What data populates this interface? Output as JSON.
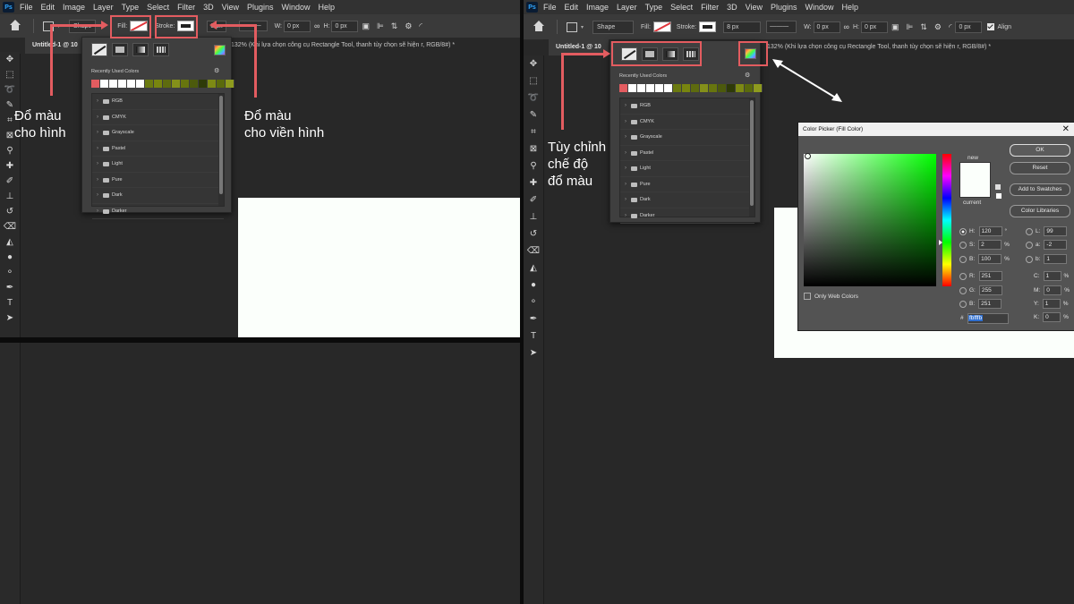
{
  "left": {
    "menu": [
      "File",
      "Edit",
      "Image",
      "Layer",
      "Type",
      "Select",
      "Filter",
      "3D",
      "View",
      "Plugins",
      "Window",
      "Help"
    ],
    "options": {
      "shape_label": "Shape",
      "fill_label": "Fill:",
      "stroke_label": "Stroke:",
      "stroke_width": "8 px",
      "w_label": "W:",
      "w_value": "0 px",
      "h_label": "H:",
      "h_value": "0 px"
    },
    "tab_label": "Untitled-1 @ 10",
    "title_text": "132% (Khi lựa chọn công cụ  Rectangle Tool, thanh  tùy chọn sẽ hiện r, RGB/8#) *",
    "swatches": {
      "recent_label": "Recently Used Colors",
      "recent_colors": [
        "#e35c60",
        "#ffffff",
        "#ffffff",
        "#ffffff",
        "#ffffff",
        "#ffffff",
        "#6b7a10",
        "#78850f",
        "#5e6b0f",
        "#84901a",
        "#67750e",
        "#4c5a0c",
        "#2e3a08",
        "#7d8a14",
        "#5a6a0c",
        "#8e9b1e"
      ],
      "folders": [
        "RGB",
        "CMYK",
        "Grayscale",
        "Pastel",
        "Light",
        "Pure",
        "Dark",
        "Darker"
      ]
    },
    "ann_fill": [
      "Đổ màu",
      "cho hình"
    ],
    "ann_stroke": [
      "Đổ màu",
      "cho viền hình"
    ]
  },
  "right": {
    "menu": [
      "File",
      "Edit",
      "Image",
      "Layer",
      "Type",
      "Select",
      "Filter",
      "3D",
      "View",
      "Plugins",
      "Window",
      "Help"
    ],
    "options": {
      "shape_label": "Shape",
      "fill_label": "Fill:",
      "stroke_label": "Stroke:",
      "stroke_width": "8 px",
      "w_label": "W:",
      "w_value": "0 px",
      "h_label": "H:",
      "h_value": "0 px",
      "radius_value": "0 px",
      "align_label": "Align"
    },
    "tab_label": "Untitled-1 @ 10",
    "title_text": "132% (Khi lựa chọn công cụ  Rectangle Tool, thanh  tùy chọn sẽ hiện r, RGB/8#) *",
    "swatches": {
      "recent_label": "Recently Used Colors",
      "recent_colors": [
        "#e35c60",
        "#ffffff",
        "#ffffff",
        "#ffffff",
        "#ffffff",
        "#ffffff",
        "#6b7a10",
        "#78850f",
        "#5e6b0f",
        "#84901a",
        "#67750e",
        "#4c5a0c",
        "#2e3a08",
        "#7d8a14",
        "#5a6a0c",
        "#8e9b1e"
      ],
      "folders": [
        "RGB",
        "CMYK",
        "Grayscale",
        "Pastel",
        "Light",
        "Pure",
        "Dark",
        "Darker"
      ]
    },
    "ann_mode": [
      "Tùy chỉnh",
      "chế độ",
      "đổ màu"
    ],
    "color_picker": {
      "title": "Color Picker (Fill Color)",
      "ok": "OK",
      "reset": "Reset",
      "add_to_swatches": "Add to Swatches",
      "color_libraries": "Color Libraries",
      "new_label": "new",
      "current_label": "current",
      "only_web": "Only Web Colors",
      "hsb": [
        {
          "k": "H:",
          "v": "120",
          "u": "°"
        },
        {
          "k": "S:",
          "v": "2",
          "u": "%"
        },
        {
          "k": "B:",
          "v": "100",
          "u": "%"
        }
      ],
      "rgb": [
        {
          "k": "R:",
          "v": "251"
        },
        {
          "k": "G:",
          "v": "255"
        },
        {
          "k": "B:",
          "v": "251"
        }
      ],
      "lab": [
        {
          "k": "L:",
          "v": "99"
        },
        {
          "k": "a:",
          "v": "-2"
        },
        {
          "k": "b:",
          "v": "1"
        }
      ],
      "cmyk": [
        {
          "k": "C:",
          "v": "1",
          "u": "%"
        },
        {
          "k": "M:",
          "v": "0",
          "u": "%"
        },
        {
          "k": "Y:",
          "v": "1",
          "u": "%"
        },
        {
          "k": "K:",
          "v": "0",
          "u": "%"
        }
      ],
      "hex_label": "#",
      "hex": "fbfffb",
      "new_color": "#fbfffb",
      "current_color": "#fbfffb"
    }
  },
  "colors": {
    "highlight": "#e35c60",
    "menubar": "#323232",
    "optionbar": "#3a3a3a",
    "canvas": "#fbfffb"
  }
}
